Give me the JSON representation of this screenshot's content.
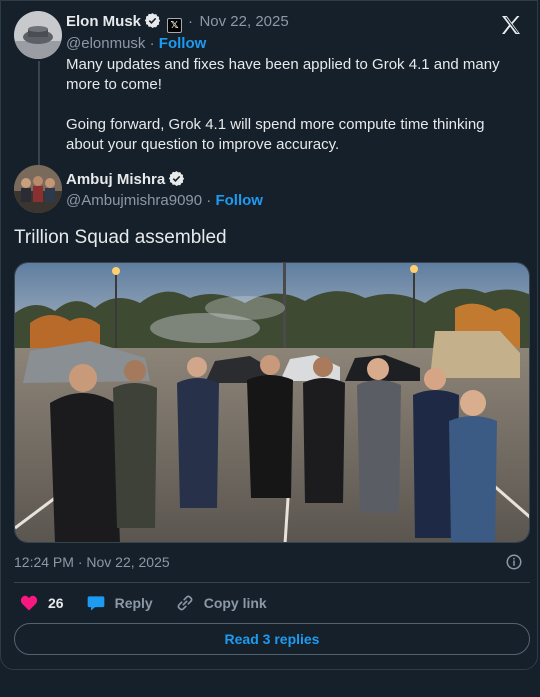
{
  "parent_tweet": {
    "author_name": "Elon Musk",
    "handle": "@elonmusk",
    "date": "Nov 22, 2025",
    "follow_label": "Follow",
    "text_lines": [
      "Many updates and fixes have been applied to Grok 4.1 and many",
      "more to come!",
      "Going forward, Grok 4.1 will spend more compute time thinking",
      "about your question to improve accuracy."
    ]
  },
  "main_tweet": {
    "author_name": "Ambuj Mishra",
    "handle": "@Ambujmishra9090",
    "follow_label": "Follow",
    "text": "Trillion Squad assembled",
    "timestamp": "12:24 PM · Nov 22, 2025"
  },
  "actions": {
    "like_count": "26",
    "reply_label": "Reply",
    "copy_link_label": "Copy link"
  },
  "read_replies_label": "Read 3 replies",
  "badges": {
    "affiliate_badge": "𝕏"
  },
  "colors": {
    "background": "#15202b",
    "accent": "#1d9bf0",
    "like": "#f91880",
    "text": "#e7e9ea",
    "muted": "#8b98a5"
  }
}
